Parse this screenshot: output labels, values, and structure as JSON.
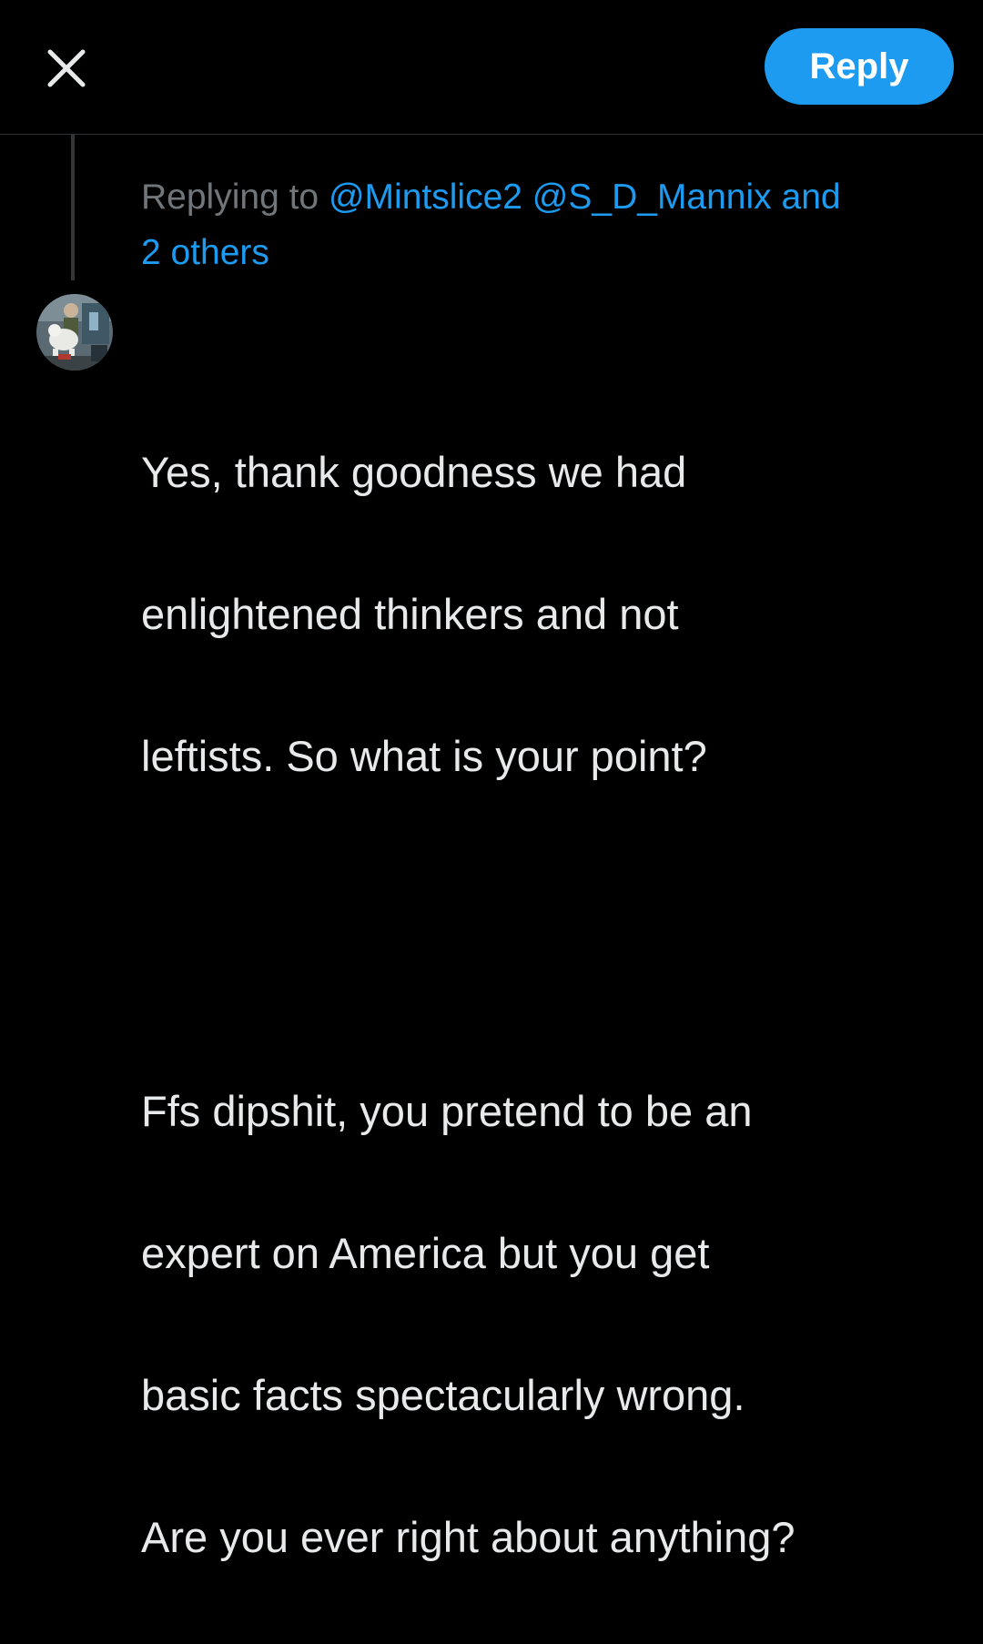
{
  "colors": {
    "accent": "#1d9bf0",
    "link": "#1d9bf0",
    "background": "#000000",
    "text": "#e7e9ea",
    "muted": "#71767b"
  },
  "header": {
    "close_icon": "close-icon",
    "reply_label": "Reply"
  },
  "reply_context": {
    "prefix": "Replying to",
    "mentions": [
      "@Mintslice2",
      "@S_D_Mannix"
    ],
    "and_text": "and",
    "others": "2 others"
  },
  "tweet": {
    "avatar_icon": "avatar-photo",
    "paragraphs": [
      [
        "Yes, thank goodness we had",
        "enlightened thinkers and not",
        "leftists. So what is your point?"
      ],
      [
        "Ffs dipshit, you pretend to be an",
        "expert on America but you get",
        "basic facts spectacularly wrong.",
        "Are you ever right about anything?"
      ]
    ]
  }
}
